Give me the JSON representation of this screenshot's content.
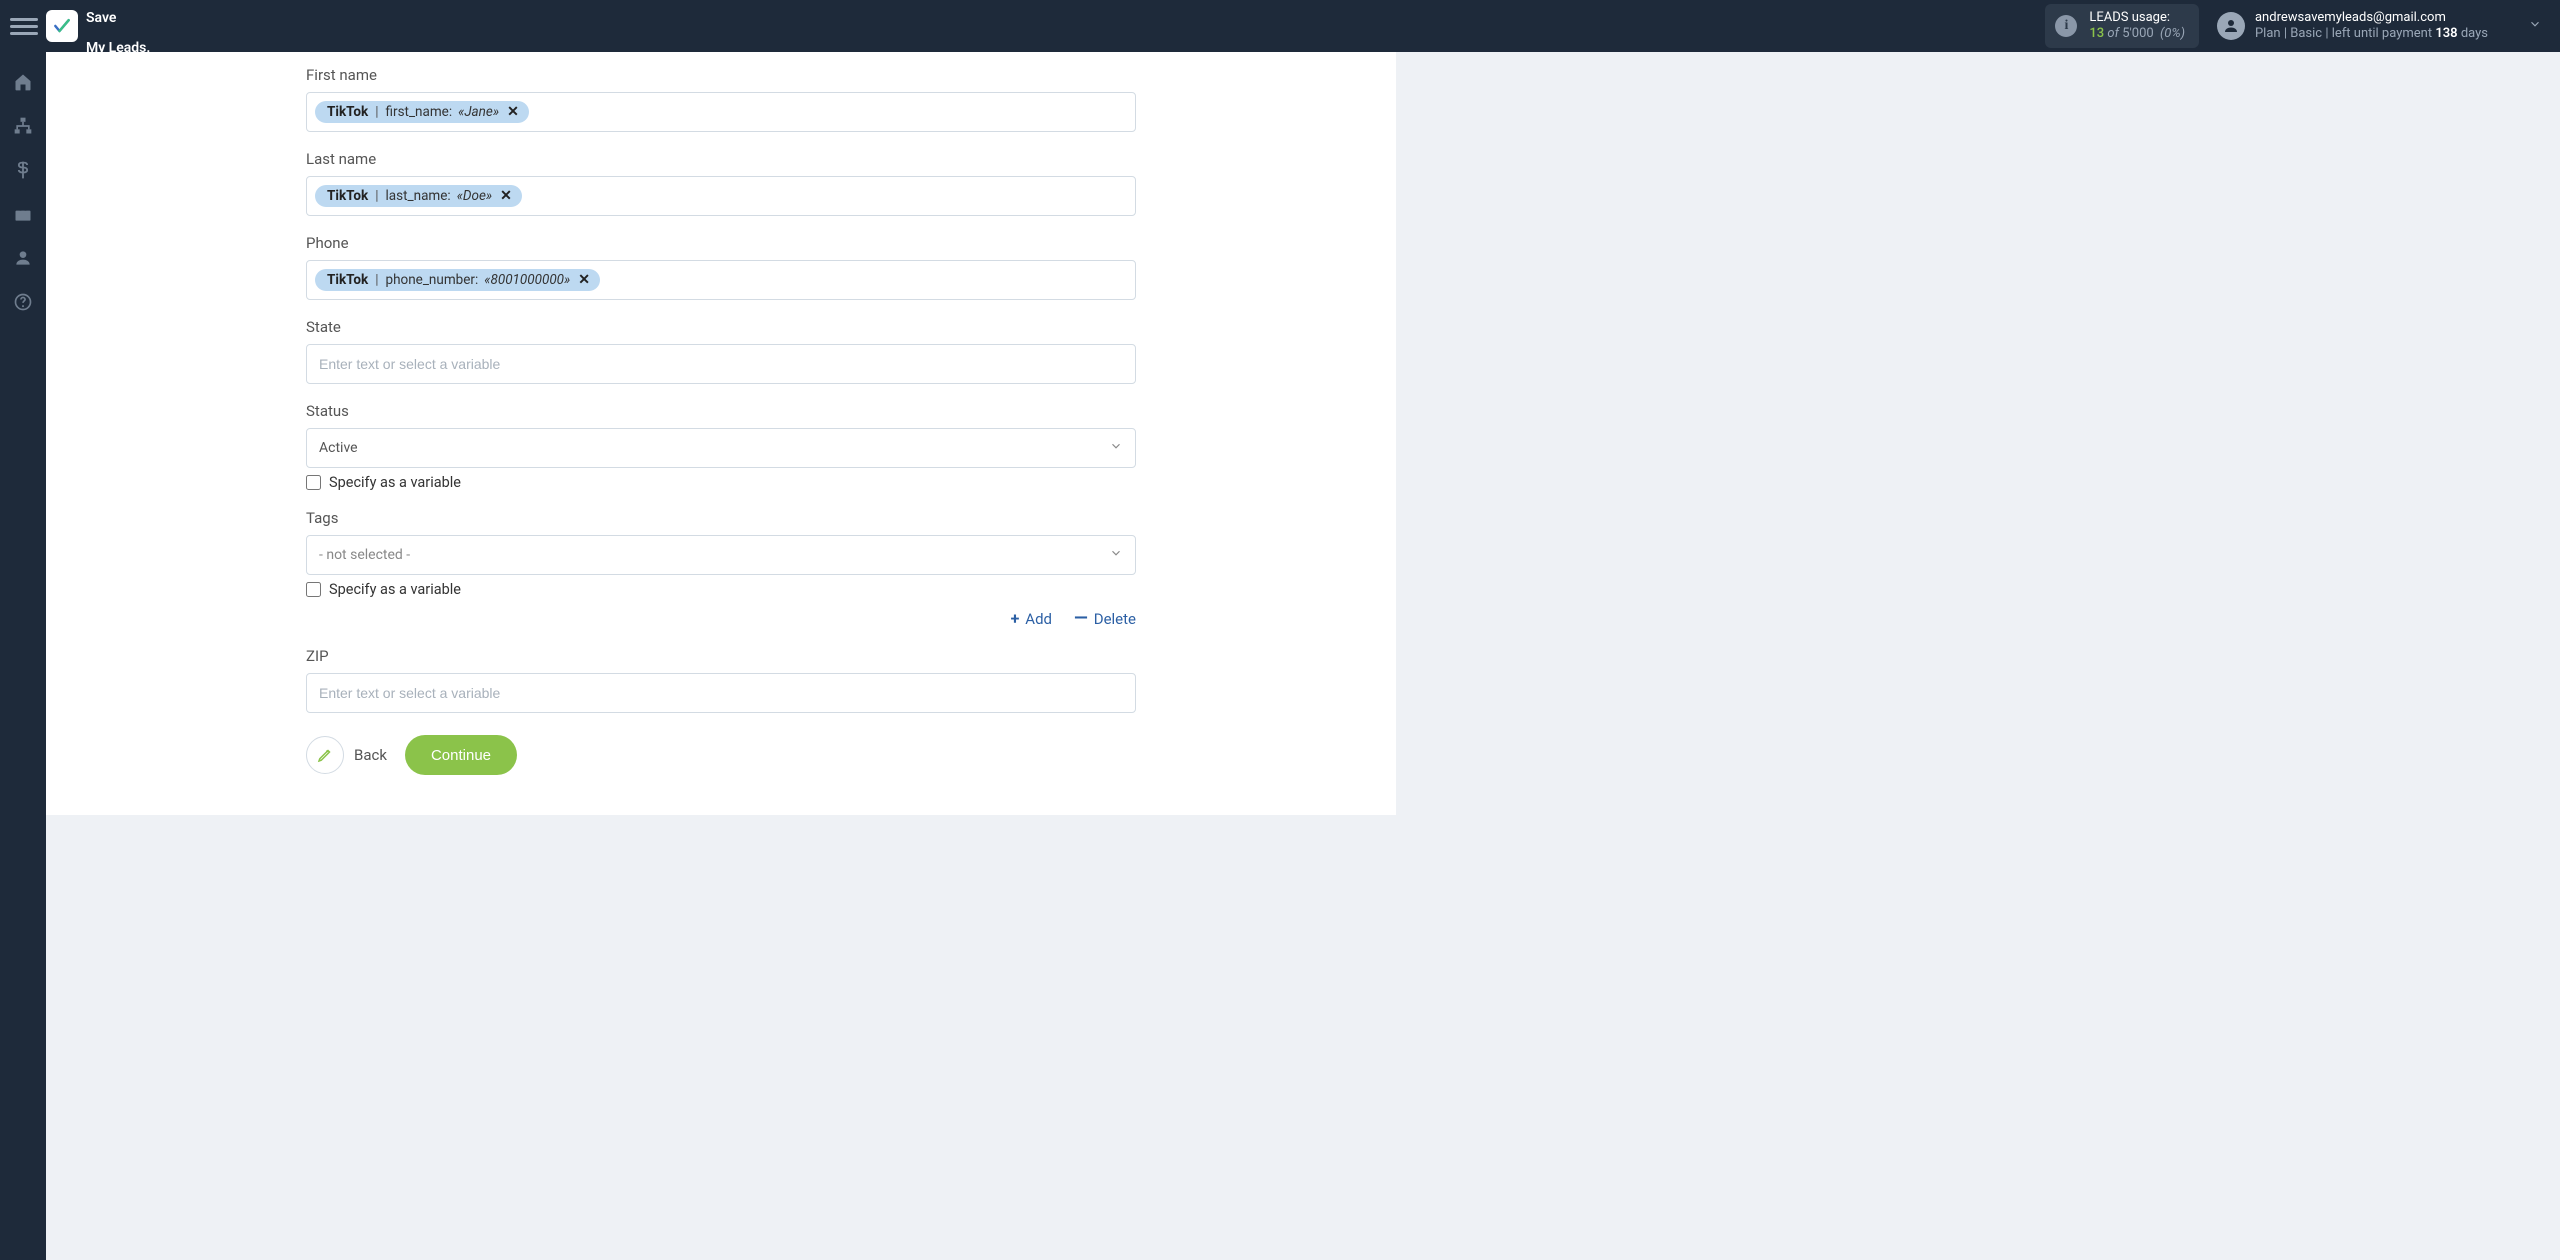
{
  "brand": {
    "name_line1": "Save",
    "name_line2": "My Leads."
  },
  "header": {
    "usage_label": "LEADS usage:",
    "usage_count": "13",
    "usage_of": "of",
    "usage_total": "5'000",
    "usage_pct": "(0%)",
    "email": "andrewsavemyleads@gmail.com",
    "plan_prefix": "Plan |",
    "plan_name": "Basic",
    "plan_mid": "| left until payment",
    "plan_days_num": "138",
    "plan_days_word": "days"
  },
  "form": {
    "first_name": {
      "label": "First name",
      "chip_source": "TikTok",
      "chip_field": "first_name:",
      "chip_sample": "«Jane»"
    },
    "last_name": {
      "label": "Last name",
      "chip_source": "TikTok",
      "chip_field": "last_name:",
      "chip_sample": "«Doe»"
    },
    "phone": {
      "label": "Phone",
      "chip_source": "TikTok",
      "chip_field": "phone_number:",
      "chip_sample": "«8001000000»"
    },
    "state": {
      "label": "State",
      "placeholder": "Enter text or select a variable"
    },
    "status": {
      "label": "Status",
      "value": "Active",
      "specify_label": "Specify as a variable"
    },
    "tags": {
      "label": "Tags",
      "value": "- not selected -",
      "specify_label": "Specify as a variable",
      "add_label": "Add",
      "delete_label": "Delete"
    },
    "zip": {
      "label": "ZIP",
      "placeholder": "Enter text or select a variable"
    },
    "buttons": {
      "back": "Back",
      "continue": "Continue"
    }
  }
}
